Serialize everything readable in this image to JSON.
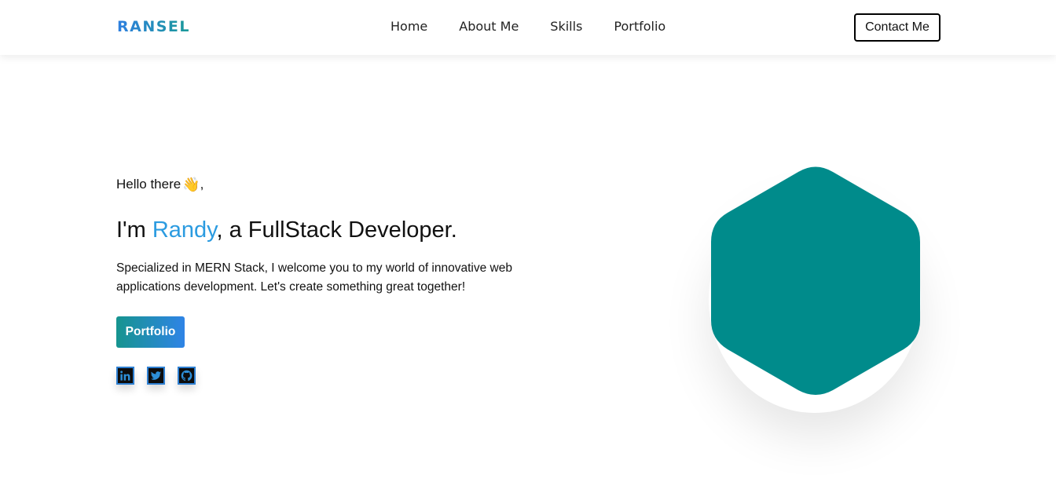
{
  "nav": {
    "logo": "RANSEL",
    "links": [
      "Home",
      "About Me",
      "Skills",
      "Portfolio"
    ],
    "contact_label": "Contact Me"
  },
  "hero": {
    "greeting": "Hello there",
    "greeting_emoji": "👋",
    "greeting_comma": ",",
    "headline_prefix": "I'm ",
    "headline_name": "Randy",
    "headline_suffix": ", a FullStack Developer.",
    "description": "Specialized in MERN Stack, I welcome you to my world of innovative web applications development. Let's create something great together!",
    "button_label": "Portfolio"
  },
  "socials": [
    {
      "icon": "linkedin-icon"
    },
    {
      "icon": "twitter-icon"
    },
    {
      "icon": "github-icon"
    }
  ],
  "colors": {
    "accent_blue": "#2b9be0",
    "hexagon": "#008b8b",
    "button_gradient_start": "#16948f",
    "button_gradient_end": "#2f84e6"
  }
}
